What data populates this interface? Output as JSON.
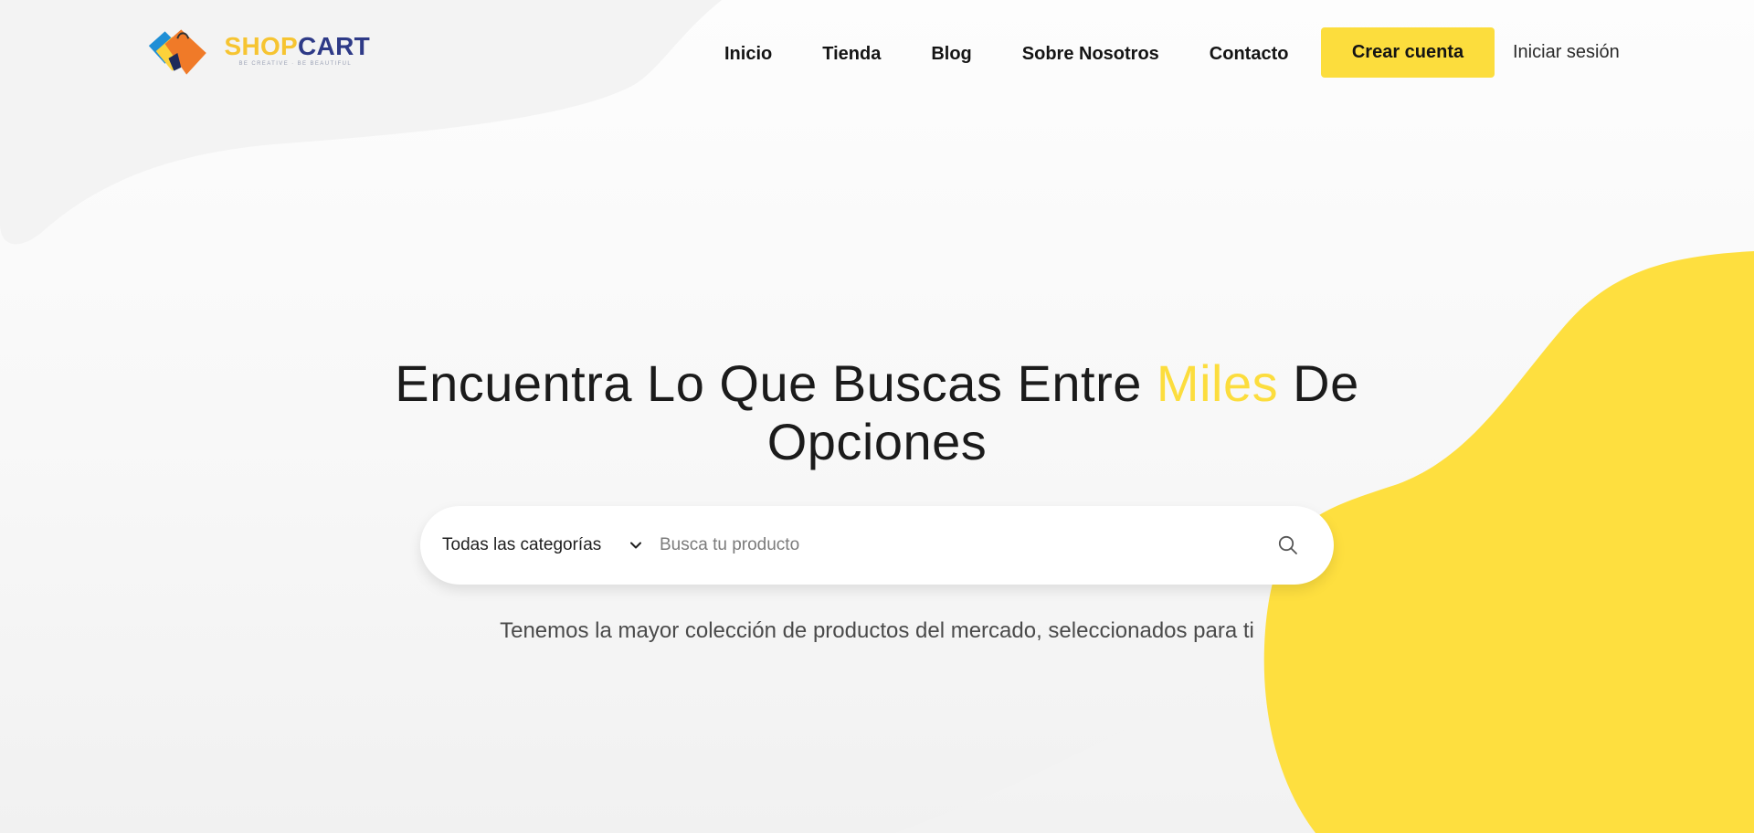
{
  "brand": {
    "word_shop": "SHOP",
    "word_cart": "CART",
    "tagline": "BE CREATIVE · BE BEAUTIFUL",
    "colors": {
      "shop": "#f6c431",
      "cart": "#2e3a87",
      "accent": "#fcdd3d"
    }
  },
  "nav": {
    "items": [
      {
        "label": "Inicio"
      },
      {
        "label": "Tienda"
      },
      {
        "label": "Blog"
      },
      {
        "label": "Sobre Nosotros"
      },
      {
        "label": "Contacto"
      }
    ],
    "signup_label": "Crear cuenta",
    "login_label": "Iniciar sesión"
  },
  "hero": {
    "title_before": "Encuentra Lo Que Buscas Entre ",
    "title_accent": "Miles",
    "title_after": " De Opciones",
    "subtitle": "Tenemos la mayor colección de productos del mercado, seleccionados para ti"
  },
  "search": {
    "category_selected": "Todas las categorías",
    "placeholder": "Busca tu producto",
    "value": "",
    "search_icon": "search-icon",
    "chevron_icon": "chevron-down-icon"
  }
}
